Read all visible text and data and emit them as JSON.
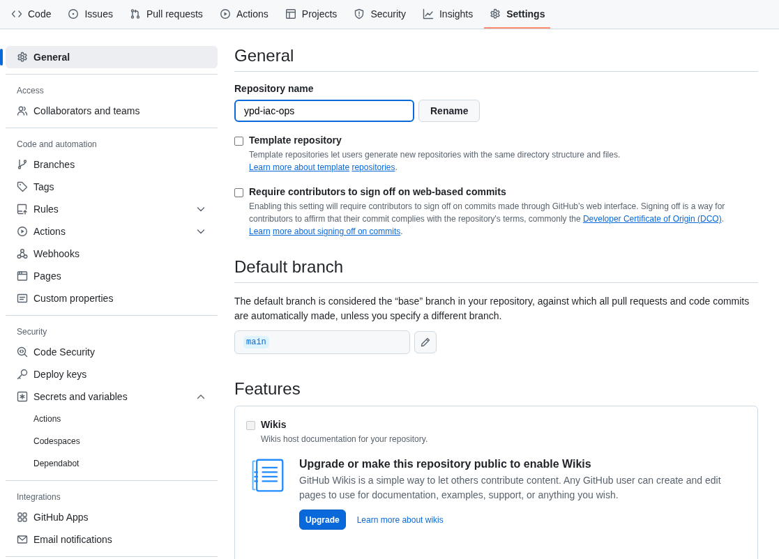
{
  "nav_tabs": [
    {
      "label": "Code",
      "selected": false
    },
    {
      "label": "Issues",
      "selected": false
    },
    {
      "label": "Pull requests",
      "selected": false
    },
    {
      "label": "Actions",
      "selected": false
    },
    {
      "label": "Projects",
      "selected": false
    },
    {
      "label": "Security",
      "selected": false
    },
    {
      "label": "Insights",
      "selected": false
    },
    {
      "label": "Settings",
      "selected": true
    }
  ],
  "sidebar": {
    "sections": [
      {
        "items": [
          {
            "label": "General",
            "selected": true
          }
        ]
      },
      {
        "heading": "Access",
        "items": [
          {
            "label": "Collaborators and teams",
            "selected": false
          }
        ]
      },
      {
        "heading": "Code and automation",
        "items": [
          {
            "label": "Branches",
            "selected": false
          },
          {
            "label": "Tags",
            "selected": false
          },
          {
            "label": "Rules",
            "selected": false,
            "expanded": false
          },
          {
            "label": "Actions",
            "selected": false,
            "expanded": false
          },
          {
            "label": "Webhooks",
            "selected": false
          },
          {
            "label": "Pages",
            "selected": false
          },
          {
            "label": "Custom properties",
            "selected": false
          }
        ]
      },
      {
        "heading": "Security",
        "items": [
          {
            "label": "Code Security",
            "selected": false
          },
          {
            "label": "Deploy keys",
            "selected": false
          },
          {
            "label": "Secrets and variables",
            "selected": false,
            "expanded": true,
            "children": [
              {
                "label": "Actions",
                "selected": false
              },
              {
                "label": "Codespaces",
                "selected": false
              },
              {
                "label": "Dependabot",
                "selected": false
              }
            ]
          }
        ]
      },
      {
        "heading": "Integrations",
        "items": [
          {
            "label": "GitHub Apps",
            "selected": false
          },
          {
            "label": "Email notifications",
            "selected": false
          }
        ]
      }
    ]
  },
  "general": {
    "title": "General",
    "repository_name": {
      "label": "Repository name",
      "value": "ypd-iac-ops",
      "button": "Rename"
    },
    "options": [
      {
        "label": "Template repository",
        "checked": false,
        "description": [
          {
            "kind": "text",
            "text": "Template repositories let users generate new repositories with the same directory structure and files. "
          },
          {
            "kind": "link",
            "text": "Learn more about template"
          },
          {
            "kind": "link",
            "text": "repositories"
          },
          {
            "kind": "text",
            "text": "."
          }
        ]
      },
      {
        "label": "Require contributors to sign off on web-based commits",
        "checked": false,
        "description": [
          {
            "kind": "text",
            "text": "Enabling this setting will require contributors to sign off on commits made through GitHub’s web interface. Signing off is a way for contributors to affirm that their commit complies with the repository's terms, commonly the "
          },
          {
            "kind": "link",
            "text": "Developer Certificate of Origin (DCO)"
          },
          {
            "kind": "text",
            "text": ". "
          },
          {
            "kind": "link",
            "text": "Learn"
          },
          {
            "kind": "link",
            "text": "more about signing off on commits"
          },
          {
            "kind": "text",
            "text": "."
          }
        ]
      }
    ]
  },
  "default_branch": {
    "title": "Default branch",
    "description": "The default branch is considered the “base” branch in your repository, against which all pull requests and code commits are automatically made, unless you specify a different branch.",
    "branch": "main"
  },
  "features": {
    "title": "Features",
    "wikis": {
      "label": "Wikis",
      "checked": false,
      "disabled": true,
      "description": "Wikis host documentation for your repository.",
      "upgrade_title": "Upgrade or make this repository public to enable Wikis",
      "upgrade_text": "GitHub Wikis is a simple way to let others contribute content. Any GitHub user can create and edit pages to use for documentation, examples, support, or anything you wish.",
      "button": "Upgrade",
      "link": "Learn more about wikis"
    }
  }
}
